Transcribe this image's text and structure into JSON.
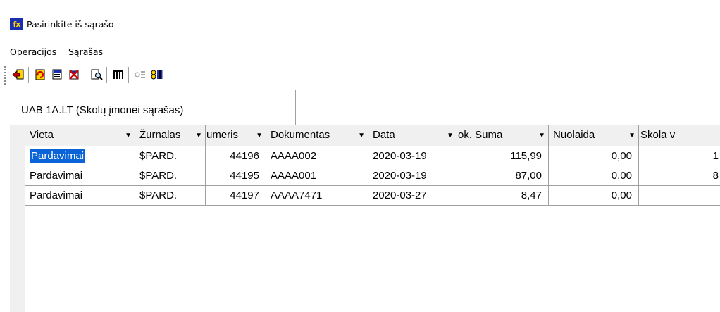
{
  "window": {
    "icon_label": "fx",
    "title": "Pasirinkite iš sąrašo"
  },
  "menu": {
    "items": [
      "Operacijos",
      "Sąrašas"
    ]
  },
  "toolbar": {
    "buttons": [
      "enter-icon",
      "refresh-icon",
      "edit-icon",
      "delete-icon",
      "search-icon",
      "columns-icon",
      "filter-icon",
      "sort-icon"
    ]
  },
  "grid": {
    "group_header": "UAB 1A.LT (Skolų įmonei sąrašas)",
    "columns": [
      "Vieta",
      "Žurnalas",
      "umeris",
      "Dokumentas",
      "Data",
      "ok. Suma",
      "Nuolaida",
      "Skola v"
    ],
    "rows": [
      {
        "vieta": "Pardavimai",
        "zurnalas": "$PARD.",
        "numeris": "44196",
        "dokumentas": "AAAA002",
        "data": "2020-03-19",
        "suma": "115,99",
        "nuolaida": "0,00",
        "skola": "1"
      },
      {
        "vieta": "Pardavimai",
        "zurnalas": "$PARD.",
        "numeris": "44195",
        "dokumentas": "AAAA001",
        "data": "2020-03-19",
        "suma": "87,00",
        "nuolaida": "0,00",
        "skola": "8"
      },
      {
        "vieta": "Pardavimai",
        "zurnalas": "$PARD.",
        "numeris": "44197",
        "dokumentas": "AAAA7471",
        "data": "2020-03-27",
        "suma": "8,47",
        "nuolaida": "0,00",
        "skola": ""
      }
    ],
    "selected_row": 0
  }
}
